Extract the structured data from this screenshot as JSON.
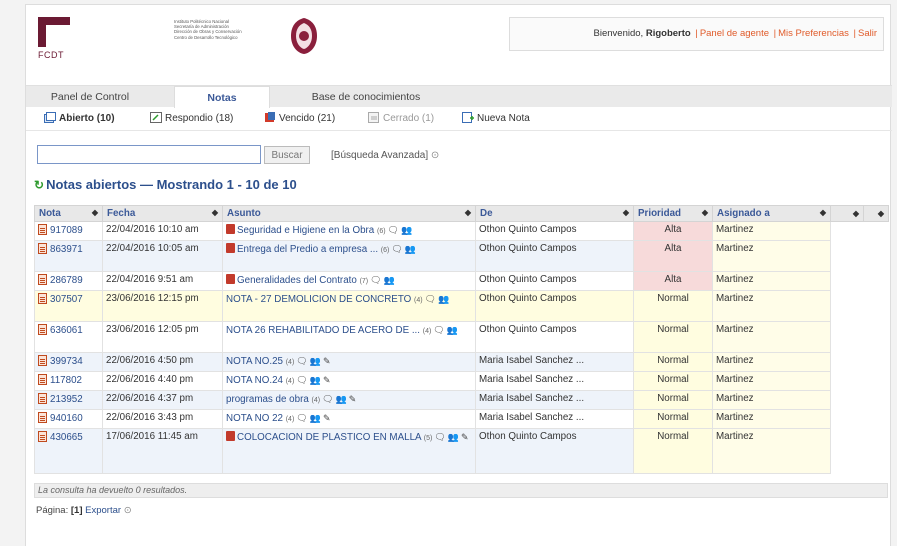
{
  "header": {
    "logo_text": "FCDT",
    "institution_lines": [
      "Instituto Politécnico Nacional",
      "Secretaría de Administración",
      "Dirección de Obras y Conservación",
      "Centro de Desarrollo Tecnológico"
    ],
    "welcome_prefix": "Bienvenido,",
    "user_name": "Rigoberto",
    "links": [
      "Panel de agente",
      "Mis Preferencias",
      "Salir"
    ]
  },
  "tabs": [
    {
      "label": "Panel de Control",
      "active": false
    },
    {
      "label": "Notas",
      "active": true
    },
    {
      "label": "Base de conocimientos",
      "active": false
    }
  ],
  "subnav": [
    {
      "label": "Abierto (10)",
      "icon": "open-folder-icon",
      "bold": true
    },
    {
      "label": "Respondio (18)",
      "icon": "reply-icon"
    },
    {
      "label": "Vencido (21)",
      "icon": "overdue-icon"
    },
    {
      "label": "Cerrado (1)",
      "icon": "closed-icon"
    },
    {
      "label": "Nueva Nota",
      "icon": "new-note-icon"
    }
  ],
  "search": {
    "value": "",
    "button_label": "Buscar",
    "advanced_label": "[Búsqueda Avanzada]"
  },
  "section_title": "Notas abiertos — Mostrando  1 - 10 de 10",
  "table": {
    "columns": [
      "Nota",
      "Fecha",
      "Asunto",
      "De",
      "Prioridad",
      "Asignado a"
    ],
    "rows": [
      {
        "id": "917089",
        "date": "22/04/2016 10:10 am",
        "pdf": true,
        "subject": "Seguridad e Higiene en la Obra",
        "count": "(6)",
        "from": "Othon Quinto Campos",
        "priority": "Alta",
        "assigned": "Martinez"
      },
      {
        "id": "863971",
        "date": "22/04/2016 10:05 am",
        "pdf": true,
        "subject": "Entrega del Predio a empresa ...",
        "count": "(6)",
        "from": "Othon Quinto Campos",
        "priority": "Alta",
        "assigned": "Martinez"
      },
      {
        "id": "286789",
        "date": "22/04/2016 9:51 am",
        "pdf": true,
        "subject": "Generalidades del Contrato",
        "count": "(7)",
        "from": "Othon Quinto Campos",
        "priority": "Alta",
        "assigned": "Martinez"
      },
      {
        "id": "307507",
        "date": "23/06/2016 12:15 pm",
        "pdf": false,
        "subject": "NOTA - 27 DEMOLICION DE CONCRETO",
        "count": "(4)",
        "from": "Othon Quinto Campos",
        "priority": "Normal",
        "assigned": "Martinez"
      },
      {
        "id": "636061",
        "date": "23/06/2016 12:05 pm",
        "pdf": false,
        "subject": "NOTA 26 REHABILITADO DE ACERO DE ...",
        "count": "(4)",
        "from": "Othon Quinto Campos",
        "priority": "Normal",
        "assigned": "Martinez"
      },
      {
        "id": "399734",
        "date": "22/06/2016 4:50 pm",
        "pdf": false,
        "subject": "NOTA NO.25",
        "count": "(4)",
        "from": "Maria Isabel Sanchez ...",
        "priority": "Normal",
        "assigned": "Martinez"
      },
      {
        "id": "117802",
        "date": "22/06/2016 4:40 pm",
        "pdf": false,
        "subject": "NOTA NO.24",
        "count": "(4)",
        "from": "Maria Isabel Sanchez ...",
        "priority": "Normal",
        "assigned": "Martinez"
      },
      {
        "id": "213952",
        "date": "22/06/2016 4:37 pm",
        "pdf": false,
        "subject": "programas de obra",
        "count": "(4)",
        "from": "Maria Isabel Sanchez ...",
        "priority": "Normal",
        "assigned": "Martinez"
      },
      {
        "id": "940160",
        "date": "22/06/2016 3:43 pm",
        "pdf": false,
        "subject": "NOTA NO 22",
        "count": "(4)",
        "from": "Maria Isabel Sanchez ...",
        "priority": "Normal",
        "assigned": "Martinez"
      },
      {
        "id": "430665",
        "date": "17/06/2016 11:45 am",
        "pdf": true,
        "subject": "COLOCACION DE PLASTICO EN MALLA",
        "count": "(5)",
        "from": "Othon Quinto Campos",
        "priority": "Normal",
        "assigned": "Martinez"
      }
    ]
  },
  "footer_note": "La consulta ha devuelto 0 resultados.",
  "pager": {
    "prefix": "Página:",
    "page": "[1]",
    "export": "Exportar"
  }
}
